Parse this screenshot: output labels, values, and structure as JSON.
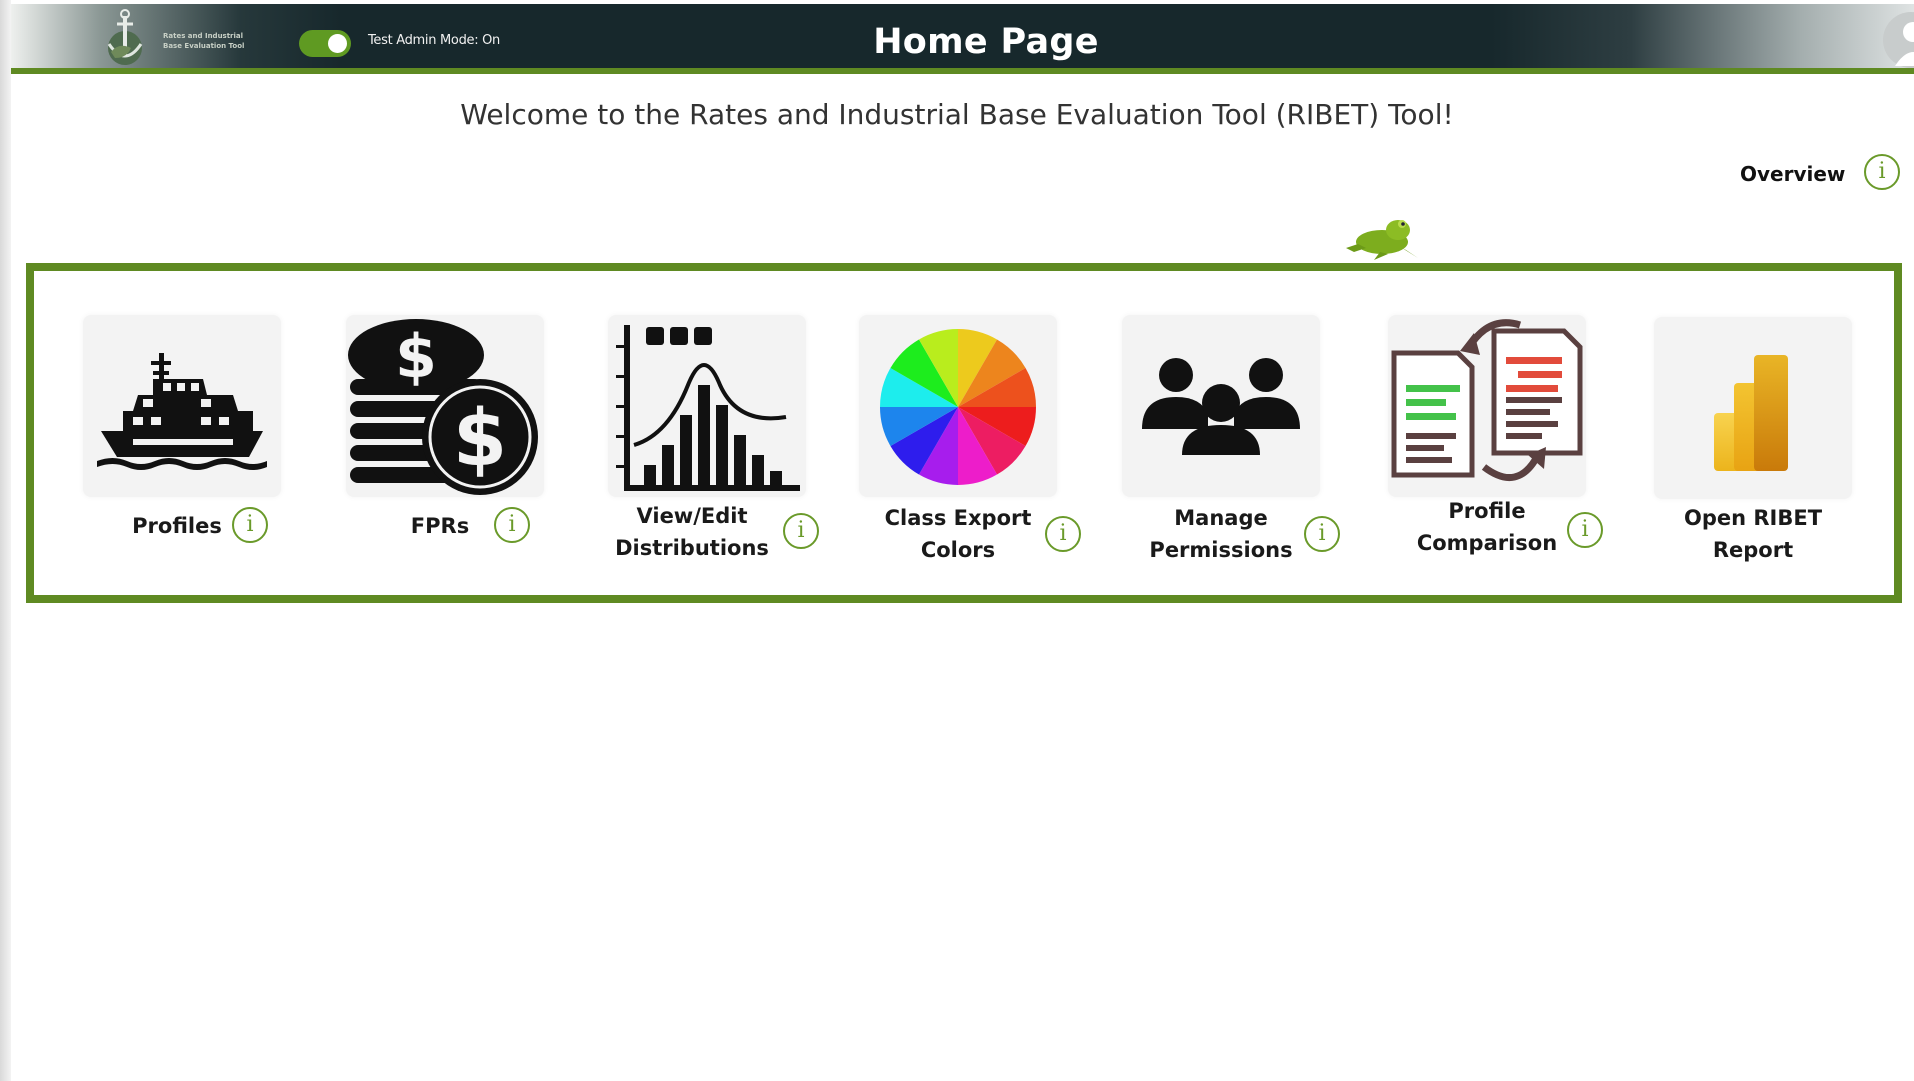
{
  "header": {
    "logo_text_line1": "Rates and Industrial",
    "logo_text_line2": "Base Evaluation Tool",
    "admin_mode_label": "Test Admin Mode: On",
    "admin_mode_on": true,
    "title": "Home Page"
  },
  "welcome": "Welcome to the Rates and Industrial Base Evaluation Tool (RIBET) Tool!",
  "overview": {
    "label": "Overview",
    "info_symbol": "i"
  },
  "tiles": [
    {
      "line1": "Profiles",
      "line2": "",
      "icon": "ship-icon",
      "has_info": true
    },
    {
      "line1": "FPRs",
      "line2": "",
      "icon": "dollar-coins-icon",
      "has_info": true
    },
    {
      "line1": "View/Edit",
      "line2": "Distributions",
      "icon": "distribution-chart-icon",
      "has_info": true
    },
    {
      "line1": "Class Export",
      "line2": "Colors",
      "icon": "color-wheel-icon",
      "has_info": true
    },
    {
      "line1": "Manage",
      "line2": "Permissions",
      "icon": "people-group-icon",
      "has_info": true
    },
    {
      "line1": "Profile",
      "line2": "Comparison",
      "icon": "document-compare-icon",
      "has_info": true
    },
    {
      "line1": "Open RIBET",
      "line2": "Report",
      "icon": "power-bi-icon",
      "has_info": false
    }
  ],
  "info_symbol": "i",
  "colors": {
    "accent_green": "#5f8a22",
    "header_dark": "#17282c",
    "info_green": "#6a9a2a"
  }
}
